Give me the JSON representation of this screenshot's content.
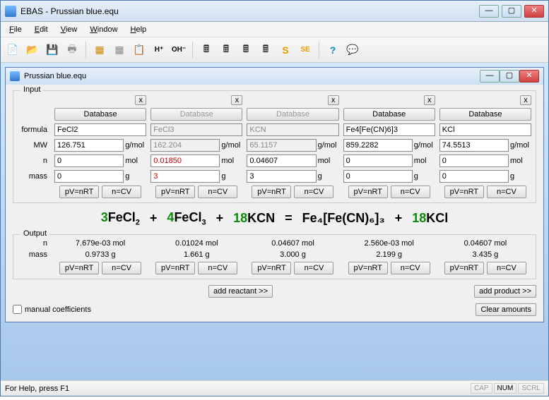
{
  "window": {
    "title": "EBAS - Prussian blue.equ"
  },
  "menu": {
    "file": "File",
    "edit": "Edit",
    "view": "View",
    "window": "Window",
    "help": "Help"
  },
  "child": {
    "title": "Prussian blue.equ"
  },
  "labels": {
    "input": "Input",
    "output": "Output",
    "formula": "formula",
    "mw": "MW",
    "n": "n",
    "mass": "mass",
    "gmol": "g/mol",
    "mol": "mol",
    "g": "g",
    "database": "Database",
    "x": "x",
    "pvnrt": "pV=nRT",
    "ncv": "n=CV",
    "add_reactant": "add reactant >>",
    "add_product": "add product >>",
    "clear": "Clear amounts",
    "manual": "manual coefficients"
  },
  "cols": [
    {
      "formula": "FeCl2",
      "mw": "126.751",
      "n": "0",
      "mass": "0",
      "enabled": true
    },
    {
      "formula": "FeCl3",
      "mw": "162.204",
      "n": "0.01850",
      "n_red": true,
      "mass": "3",
      "mass_red": true,
      "enabled": false
    },
    {
      "formula": "KCN",
      "mw": "65.1157",
      "n": "0.04607",
      "mass": "3",
      "enabled": false
    },
    {
      "formula": "Fe4[Fe(CN)6]3",
      "mw": "859.2282",
      "n": "0",
      "mass": "0",
      "enabled": true
    },
    {
      "formula": "KCl",
      "mw": "74.5513",
      "n": "0",
      "mass": "0",
      "enabled": true
    }
  ],
  "equation": [
    {
      "coef": "3",
      "frag": "FeCl",
      "sub": "2"
    },
    {
      "coef": "4",
      "frag": "FeCl",
      "sub": "3"
    },
    {
      "coef": "18",
      "frag": "KCN"
    },
    {
      "eq": "="
    },
    {
      "frag2": "Fe₄[Fe(CN)₆]₃"
    },
    {
      "coef": "18",
      "frag": "KCl"
    }
  ],
  "out": [
    {
      "n": "7.679e-03 mol",
      "mass": "0.9733 g"
    },
    {
      "n": "0.01024 mol",
      "mass": "1.661 g"
    },
    {
      "n": "0.04607 mol",
      "mass": "3.000 g"
    },
    {
      "n": "2.560e-03 mol",
      "mass": "2.199 g"
    },
    {
      "n": "0.04607 mol",
      "mass": "3.435 g"
    }
  ],
  "status": {
    "help": "For Help, press F1",
    "cap": "CAP",
    "num": "NUM",
    "scrl": "SCRL"
  }
}
